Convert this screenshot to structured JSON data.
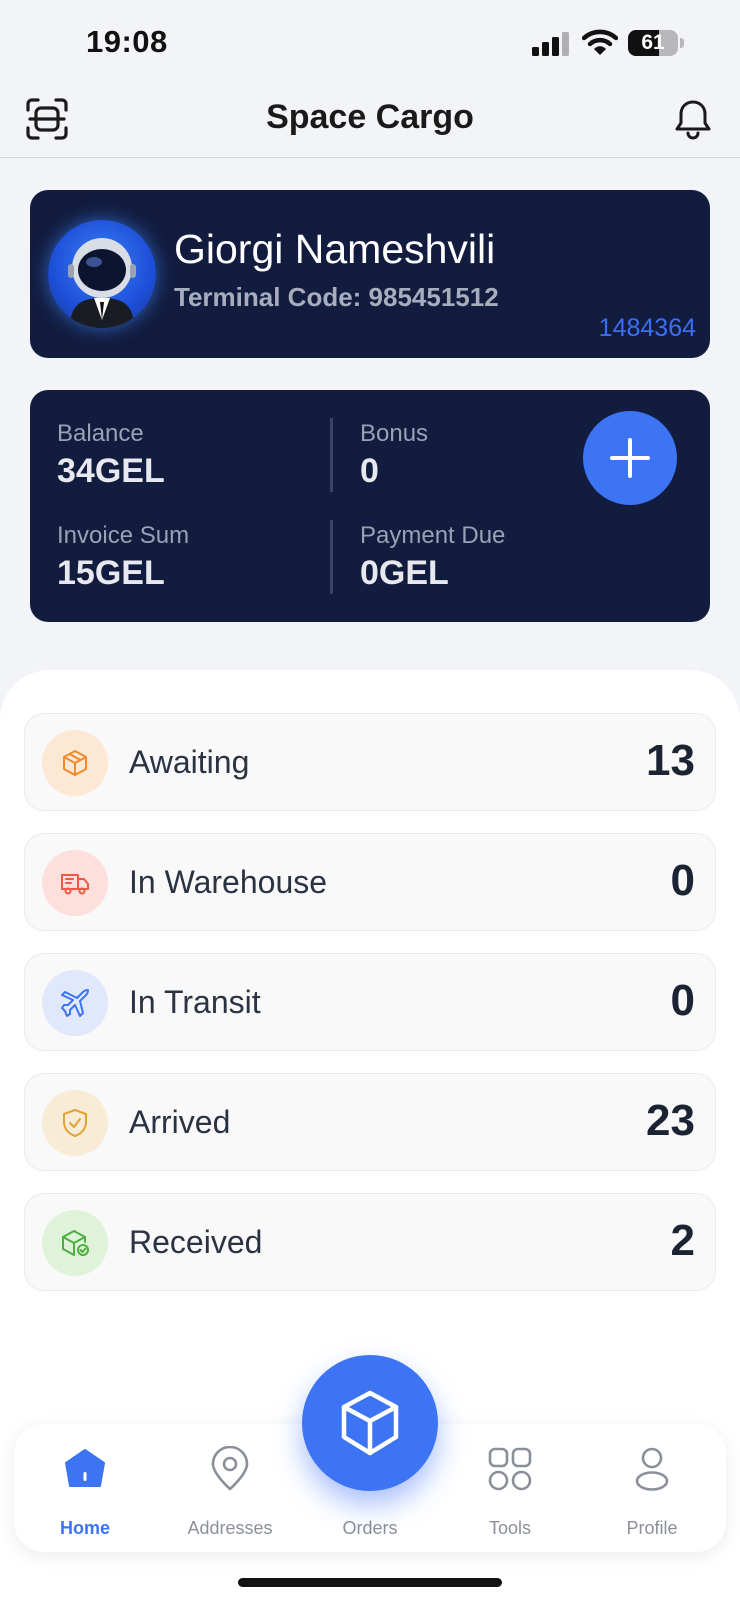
{
  "status_bar": {
    "time": "19:08",
    "battery_level": "61",
    "battery_fraction": 0.61
  },
  "header": {
    "title": "Space Cargo",
    "left_icon": "scan-icon",
    "right_icon": "bell-icon"
  },
  "profile": {
    "name": "Giorgi Nameshvili",
    "terminal_label": "Terminal Code: 985451512",
    "client_id": "1484364",
    "avatar": "astronaut-avatar"
  },
  "balance": {
    "items": [
      {
        "label": "Balance",
        "amount": "34",
        "unit": "GEL"
      },
      {
        "label": "Bonus",
        "amount": "0",
        "unit": ""
      },
      {
        "label": "Invoice Sum",
        "amount": "15",
        "unit": "GEL"
      },
      {
        "label": "Payment Due",
        "amount": "0",
        "unit": "GEL"
      }
    ],
    "add_icon": "plus-icon"
  },
  "statuses": [
    {
      "label": "Awaiting",
      "count": "13",
      "icon": "box-icon",
      "icon_bg": "#fde8d4",
      "icon_color": "#f08a2c"
    },
    {
      "label": "In Warehouse",
      "count": "0",
      "icon": "truck-icon",
      "icon_bg": "#fde0dc",
      "icon_color": "#ec5a47"
    },
    {
      "label": "In Transit",
      "count": "0",
      "icon": "plane-icon",
      "icon_bg": "#e1e8fb",
      "icon_color": "#3d74f4"
    },
    {
      "label": "Arrived",
      "count": "23",
      "icon": "shield-check-icon",
      "icon_bg": "#f8ecd6",
      "icon_color": "#e1a335"
    },
    {
      "label": "Received",
      "count": "2",
      "icon": "box-check-icon",
      "icon_bg": "#dff3da",
      "icon_color": "#4caf3f"
    }
  ],
  "nav": {
    "items": [
      {
        "label": "Home",
        "icon": "home-icon",
        "active": true
      },
      {
        "label": "Addresses",
        "icon": "map-pin-icon",
        "active": false
      },
      {
        "label": "Orders",
        "icon": "cube-icon",
        "active": false
      },
      {
        "label": "Tools",
        "icon": "grid-icon",
        "active": false
      },
      {
        "label": "Profile",
        "icon": "user-icon",
        "active": false
      }
    ]
  },
  "colors": {
    "accent": "#3d74f4",
    "card": "#121c3e",
    "background": "#f3f4f8"
  }
}
